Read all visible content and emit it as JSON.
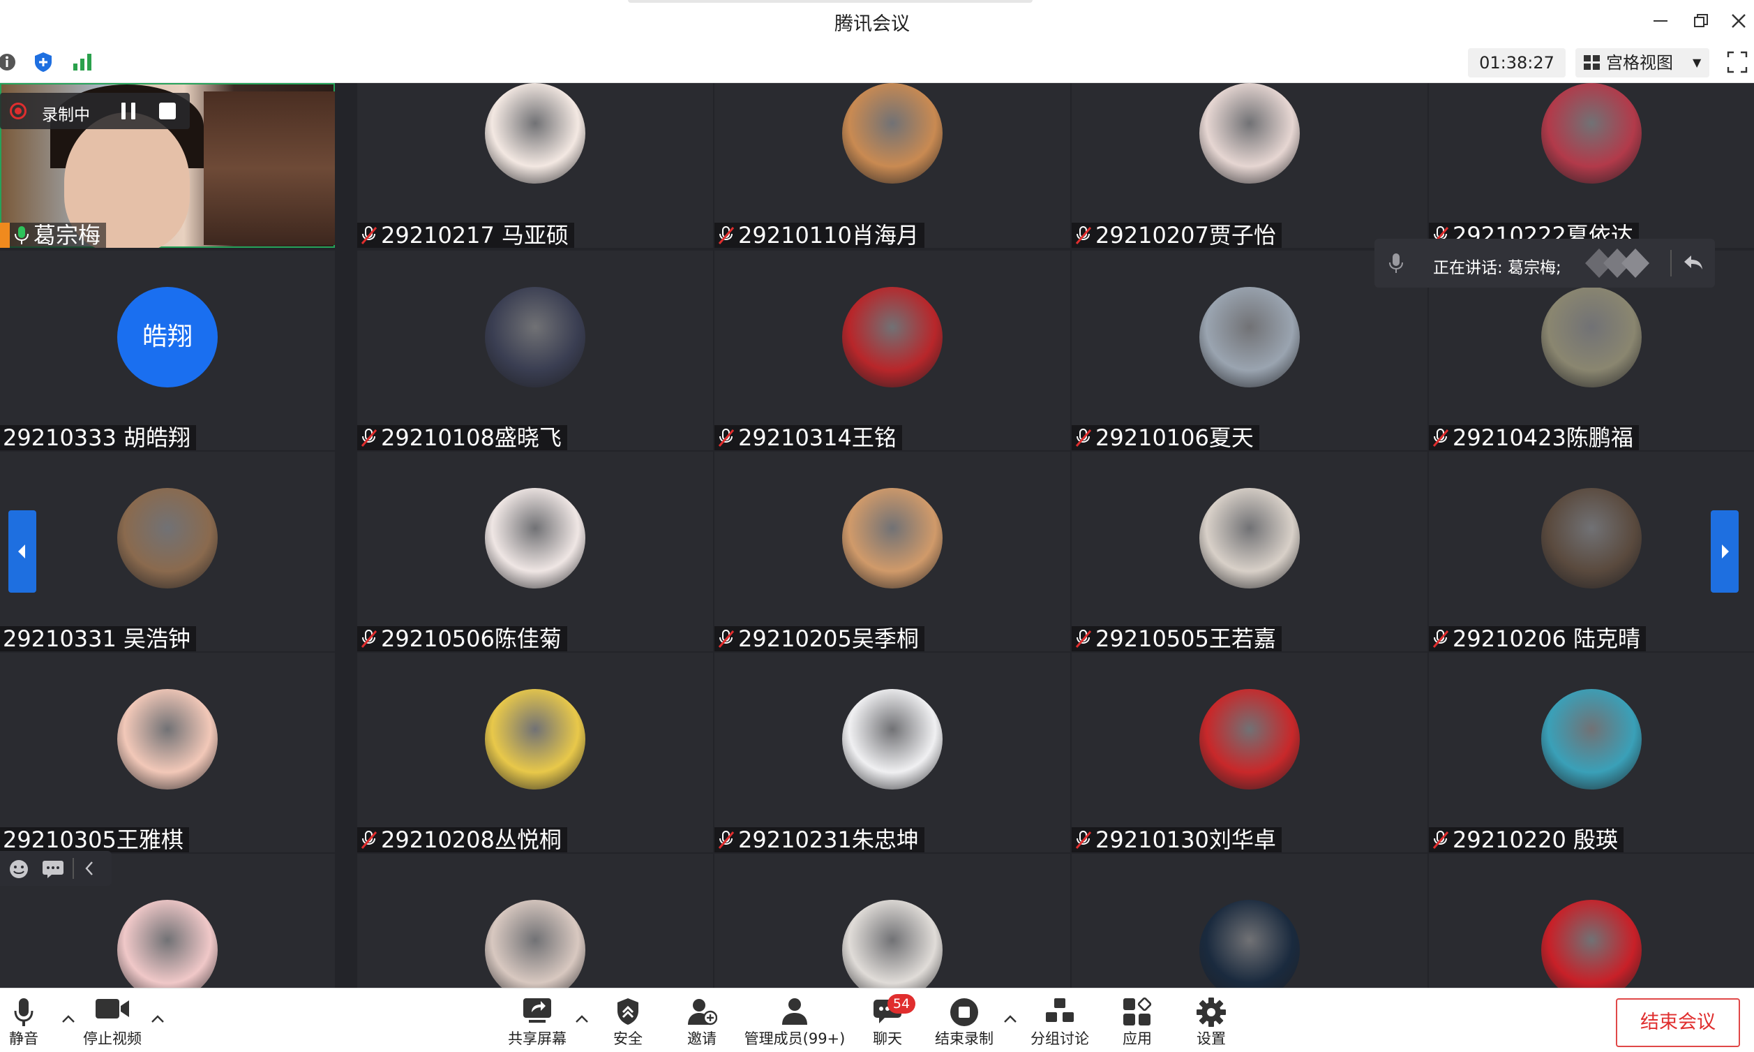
{
  "window": {
    "title": "腾讯会议"
  },
  "topbar": {
    "timer": "01:38:27",
    "view_label": "宫格视图"
  },
  "recording": {
    "label": "录制中"
  },
  "speaking_tip": {
    "text": "正在讲话: 葛宗梅;"
  },
  "participants": [
    {
      "name": "葛宗梅",
      "mic": "on",
      "avatar_color": "#c9a48a"
    },
    {
      "name": "29210217  马亚硕",
      "mic": "muted",
      "avatar_color": "#f3e8e2"
    },
    {
      "name": "29210110肖海月",
      "mic": "muted",
      "avatar_color": "#c98a52"
    },
    {
      "name": "29210207贾子怡",
      "mic": "muted",
      "avatar_color": "#e6d6d2"
    },
    {
      "name": "29210222夏依达",
      "mic": "muted",
      "avatar_color": "#b23a4a"
    },
    {
      "name": "29210333  胡皓翔",
      "mic": "none",
      "avatar_text": "皓翔",
      "avatar_color": "#1a6ff0"
    },
    {
      "name": "29210108盛晓飞",
      "mic": "muted",
      "avatar_color": "#3a3e52"
    },
    {
      "name": "29210314王铭",
      "mic": "muted",
      "avatar_color": "#b8262a"
    },
    {
      "name": "29210106夏天",
      "mic": "muted",
      "avatar_color": "#9aa4b0"
    },
    {
      "name": "29210423陈鹏福",
      "mic": "muted",
      "avatar_color": "#8a8670"
    },
    {
      "name": "29210331 吴浩钟",
      "mic": "none",
      "avatar_color": "#8a6a4e"
    },
    {
      "name": "29210506陈佳菊",
      "mic": "muted",
      "avatar_color": "#efe6e4"
    },
    {
      "name": "29210205吴季桐",
      "mic": "muted",
      "avatar_color": "#d09a6a"
    },
    {
      "name": "29210505王若嘉",
      "mic": "muted",
      "avatar_color": "#d8d0c8"
    },
    {
      "name": "29210206 陆克晴",
      "mic": "muted",
      "avatar_color": "#5a4a3e"
    },
    {
      "name": "29210305王雅棋",
      "mic": "none",
      "avatar_color": "#f2c8b8"
    },
    {
      "name": "29210208丛悦桐",
      "mic": "muted",
      "avatar_color": "#e8c84a"
    },
    {
      "name": "29210231朱忠坤",
      "mic": "muted",
      "avatar_color": "#f0f0f2"
    },
    {
      "name": "29210130刘华卓",
      "mic": "muted",
      "avatar_color": "#c8282a"
    },
    {
      "name": "29210220   殷瑛",
      "mic": "muted",
      "avatar_color": "#3aa0b8"
    },
    {
      "name": "",
      "mic": "none",
      "avatar_color": "#f0c8c8"
    },
    {
      "name": "",
      "mic": "none",
      "avatar_color": "#d8c8c0"
    },
    {
      "name": "",
      "mic": "none",
      "avatar_color": "#e0dcd8"
    },
    {
      "name": "",
      "mic": "none",
      "avatar_color": "#1a2a3e"
    },
    {
      "name": "",
      "mic": "none",
      "avatar_color": "#c82028"
    }
  ],
  "bottombar": {
    "mute": "静音",
    "stop_video": "停止视频",
    "share": "共享屏幕",
    "security": "安全",
    "invite": "邀请",
    "members": "管理成员(99+)",
    "chat": "聊天",
    "chat_badge": "54",
    "end_record": "结束录制",
    "breakout": "分组讨论",
    "apps": "应用",
    "settings": "设置",
    "end_meeting": "结束会议"
  },
  "colors": {
    "grid_bg": "#232429",
    "tile_bg": "#2a2b30",
    "accent": "#1e6fe0",
    "danger": "#e02e2e",
    "speaking_border": "#25a35a"
  }
}
